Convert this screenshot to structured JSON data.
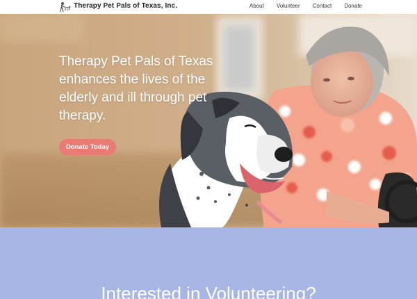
{
  "header": {
    "brand": "Therapy Pet Pals of Texas, Inc.",
    "logo_icon": "dog-walker-logo-icon",
    "nav": [
      {
        "label": "About"
      },
      {
        "label": "Volunteer"
      },
      {
        "label": "Contact"
      },
      {
        "label": "Donate"
      }
    ]
  },
  "hero": {
    "headline": "Therapy Pet Pals of Texas enhances the lives of the elderly and ill through pet therapy.",
    "cta_label": "Donate Today",
    "cta_color": "#ea7b74"
  },
  "volunteer_section": {
    "title": "Interested in Volunteering?",
    "background_color": "#a8b6e6"
  }
}
